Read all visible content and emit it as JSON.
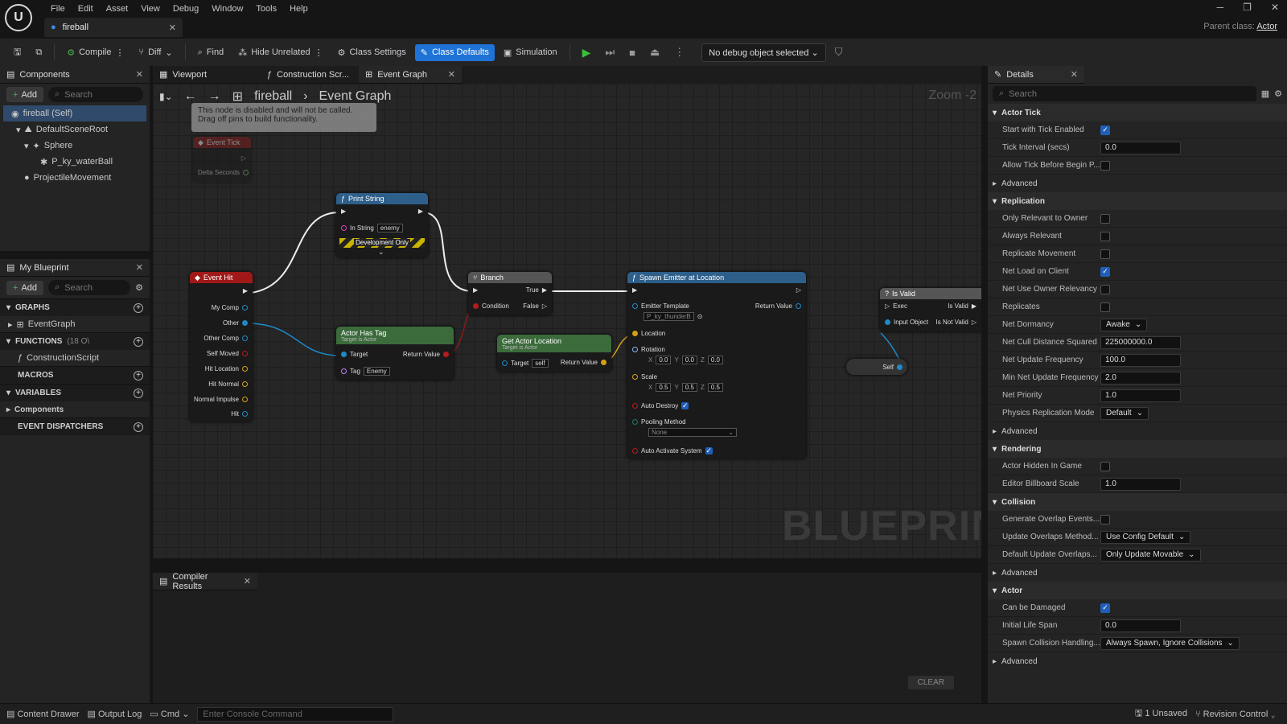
{
  "menu": [
    "File",
    "Edit",
    "Asset",
    "View",
    "Debug",
    "Window",
    "Tools",
    "Help"
  ],
  "doc_tab": "fireball",
  "parent_class_label": "Parent class:",
  "parent_class": "Actor",
  "toolbar": {
    "compile": "Compile",
    "diff": "Diff",
    "find": "Find",
    "hide_unrelated": "Hide Unrelated",
    "class_settings": "Class Settings",
    "class_defaults": "Class Defaults",
    "simulation": "Simulation",
    "debug_object": "No debug object selected"
  },
  "components": {
    "tab": "Components",
    "add": "Add",
    "search": "Search",
    "items": [
      "fireball (Self)",
      "DefaultSceneRoot",
      "Sphere",
      "P_ky_waterBall",
      "ProjectileMovement"
    ]
  },
  "my_blueprint": {
    "tab": "My Blueprint",
    "add": "Add",
    "search": "Search",
    "graphs": "GRAPHS",
    "event_graph": "EventGraph",
    "functions": "FUNCTIONS",
    "functions_count": "(18 O\\",
    "construction_script": "ConstructionScript",
    "macros": "MACROS",
    "variables": "VARIABLES",
    "components": "Components",
    "event_dispatchers": "EVENT DISPATCHERS"
  },
  "graph_tabs": [
    "Viewport",
    "Construction Scr...",
    "Event Graph"
  ],
  "breadcrumb": {
    "root": "fireball",
    "current": "Event Graph"
  },
  "zoom": "Zoom -2",
  "watermark": "BLUEPRINT",
  "disabled_note": {
    "line1": "This node is disabled and will not be called.",
    "line2": "Drag off pins to build functionality."
  },
  "nodes": {
    "event_tick": {
      "title": "Event Tick",
      "pin": "Delta Seconds"
    },
    "print_string": {
      "title": "Print String",
      "in_string_label": "In String",
      "in_string": "enemy",
      "dev": "Development Only"
    },
    "event_hit": {
      "title": "Event Hit",
      "pins": [
        "My Comp",
        "Other",
        "Other Comp",
        "Self Moved",
        "Hit Location",
        "Hit Normal",
        "Normal Impulse",
        "Hit"
      ]
    },
    "actor_has_tag": {
      "title": "Actor Has Tag",
      "sub": "Target is Actor",
      "target": "Target",
      "tag_label": "Tag",
      "tag": "Enemy",
      "ret": "Return Value"
    },
    "branch": {
      "title": "Branch",
      "cond": "Condition",
      "true": "True",
      "false": "False"
    },
    "get_actor_location": {
      "title": "Get Actor Location",
      "sub": "Target is Actor",
      "target": "Target",
      "self": "self",
      "ret": "Return Value"
    },
    "spawn_emitter": {
      "title": "Spawn Emitter at Location",
      "emitter": "Emitter Template",
      "emitter_val": "P_ky_thunderB",
      "ret": "Return Value",
      "location": "Location",
      "rotation": "Rotation",
      "rot": [
        "0.0",
        "0.0",
        "0.0"
      ],
      "scale": "Scale",
      "scl": [
        "0.5",
        "0.5",
        "0.5"
      ],
      "auto_destroy": "Auto Destroy",
      "pooling": "Pooling Method",
      "pooling_val": "None",
      "auto_activate": "Auto Activate System"
    },
    "is_valid": {
      "title": "Is Valid",
      "exec": "Exec",
      "input": "Input Object",
      "valid": "Is Valid",
      "not_valid": "Is Not Valid"
    },
    "self_node": "Self"
  },
  "compiler": {
    "tab": "Compiler Results",
    "clear": "CLEAR"
  },
  "details": {
    "tab": "Details",
    "search": "Search",
    "sections": [
      {
        "title": "Actor Tick",
        "rows": [
          {
            "label": "Start with Tick Enabled",
            "type": "check",
            "on": true
          },
          {
            "label": "Tick Interval (secs)",
            "type": "input",
            "value": "0.0"
          },
          {
            "label": "Allow Tick Before Begin P...",
            "type": "check",
            "on": false
          }
        ],
        "advanced": "Advanced"
      },
      {
        "title": "Replication",
        "rows": [
          {
            "label": "Only Relevant to Owner",
            "type": "check",
            "on": false
          },
          {
            "label": "Always Relevant",
            "type": "check",
            "on": false
          },
          {
            "label": "Replicate Movement",
            "type": "check",
            "on": false
          },
          {
            "label": "Net Load on Client",
            "type": "check",
            "on": true
          },
          {
            "label": "Net Use Owner Relevancy",
            "type": "check",
            "on": false
          },
          {
            "label": "Replicates",
            "type": "check",
            "on": false
          },
          {
            "label": "Net Dormancy",
            "type": "select",
            "value": "Awake"
          },
          {
            "label": "Net Cull Distance Squared",
            "type": "input",
            "value": "225000000.0"
          },
          {
            "label": "Net Update Frequency",
            "type": "input",
            "value": "100.0"
          },
          {
            "label": "Min Net Update Frequency",
            "type": "input",
            "value": "2.0"
          },
          {
            "label": "Net Priority",
            "type": "input",
            "value": "1.0"
          },
          {
            "label": "Physics Replication Mode",
            "type": "select",
            "value": "Default"
          }
        ],
        "advanced": "Advanced"
      },
      {
        "title": "Rendering",
        "rows": [
          {
            "label": "Actor Hidden In Game",
            "type": "check",
            "on": false
          },
          {
            "label": "Editor Billboard Scale",
            "type": "input",
            "value": "1.0"
          }
        ]
      },
      {
        "title": "Collision",
        "rows": [
          {
            "label": "Generate Overlap Events...",
            "type": "check",
            "on": false
          },
          {
            "label": "Update Overlaps Method...",
            "type": "select",
            "value": "Use Config Default"
          },
          {
            "label": "Default Update Overlaps...",
            "type": "select",
            "value": "Only Update Movable"
          }
        ],
        "advanced": "Advanced"
      },
      {
        "title": "Actor",
        "rows": [
          {
            "label": "Can be Damaged",
            "type": "check",
            "on": true
          },
          {
            "label": "Initial Life Span",
            "type": "input",
            "value": "0.0"
          },
          {
            "label": "Spawn Collision Handling...",
            "type": "select",
            "value": "Always Spawn, Ignore Collisions"
          }
        ],
        "advanced": "Advanced"
      }
    ]
  },
  "statusbar": {
    "content_drawer": "Content Drawer",
    "output_log": "Output Log",
    "cmd": "Cmd",
    "console_placeholder": "Enter Console Command",
    "unsaved": "1 Unsaved",
    "revision": "Revision Control"
  }
}
